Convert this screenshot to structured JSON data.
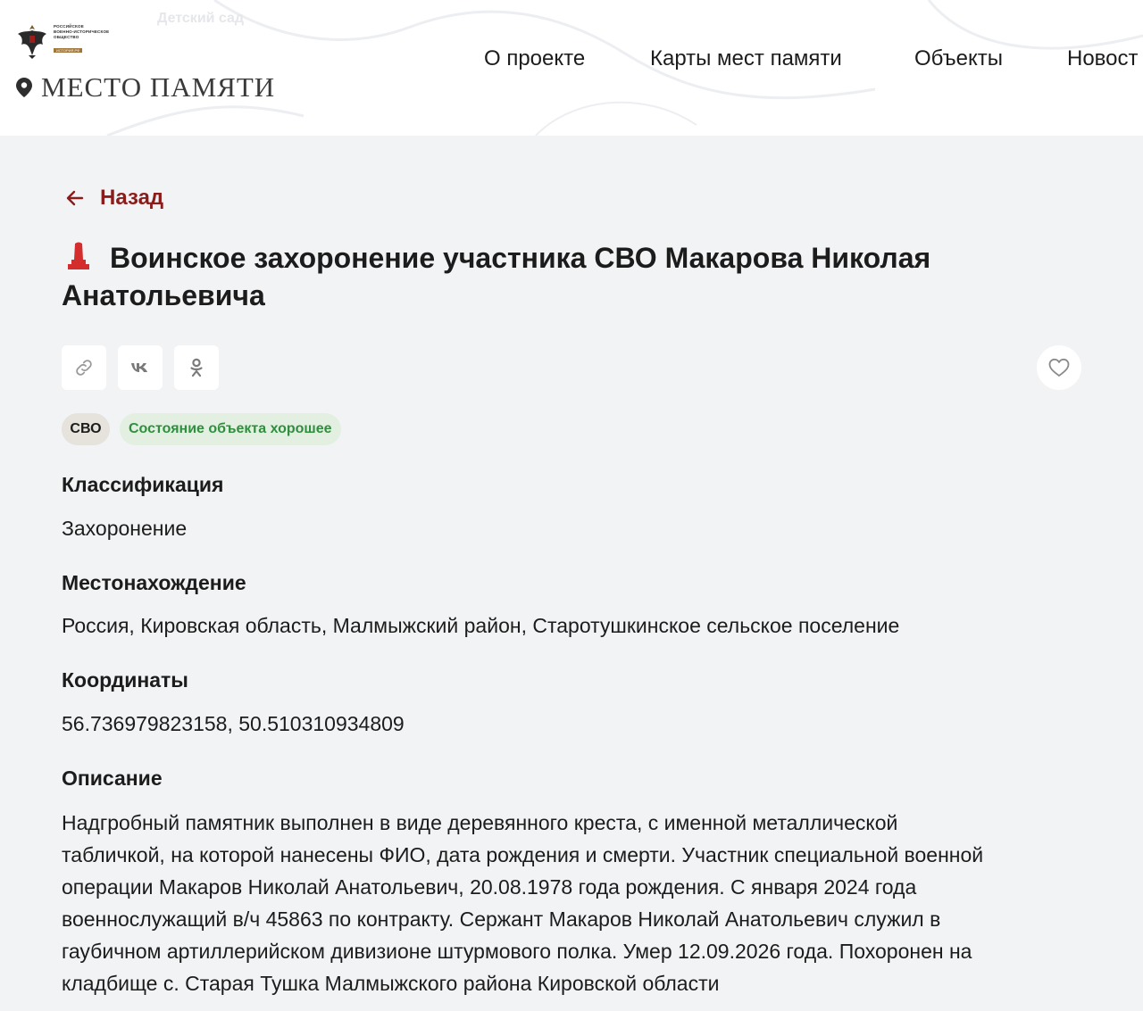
{
  "header": {
    "map_label": "Детский сад",
    "org_lines": [
      "РОССИЙСКОЕ",
      "ВОЕННО-ИСТОРИЧЕСКОЕ",
      "ОБЩЕСТВО"
    ],
    "org_badge": "ИСТОРИЯ.РФ",
    "site_name": "МЕСТО ПАМЯТИ",
    "nav": [
      "О проекте",
      "Карты мест памяти",
      "Объекты",
      "Новост"
    ]
  },
  "back_label": "Назад",
  "title": "Воинское захоронение участника СВО Макарова Николая Анатольевича",
  "share": {
    "icons": [
      "link-icon",
      "vk-icon",
      "ok-icon"
    ],
    "favorite_icon": "heart-icon"
  },
  "tags": {
    "category": "СВО",
    "state": "Состояние объекта хорошее"
  },
  "fields": {
    "classification_label": "Классификация",
    "classification_value": "Захоронение",
    "location_label": "Местонахождение",
    "location_value": "Россия, Кировская область, Малмыжский район, Старотушкинское сельское поселение",
    "coords_label": "Координаты",
    "coords_value": "56.736979823158, 50.510310934809",
    "description_label": "Описание",
    "description_lines": [
      "Надгробный памятник выполнен в виде деревянного креста, с именной металлической",
      "табличкой, на которой нанесены ФИО, дата рождения и смерти. Участник специальной военной",
      "операции Макаров Николай Анатольевич, 20.08.1978 года рождения. С января 2024 года",
      "военнослужащий в/ч 45863 по контракту. Сержант Макаров Николай Анатольевич служил в",
      "гаубичном артиллерийском дивизионе штурмового полка. Умер 12.09.2026 года. Похоронен на",
      "кладбище с. Старая Тушка Малмыжского района Кировской области"
    ]
  },
  "colors": {
    "accent": "#8b1c1c",
    "page_bg": "#f2f3f5",
    "state_green": "#2f8f3e",
    "state_bg": "#e2efe1",
    "svo_bg": "#e6e2dc"
  }
}
